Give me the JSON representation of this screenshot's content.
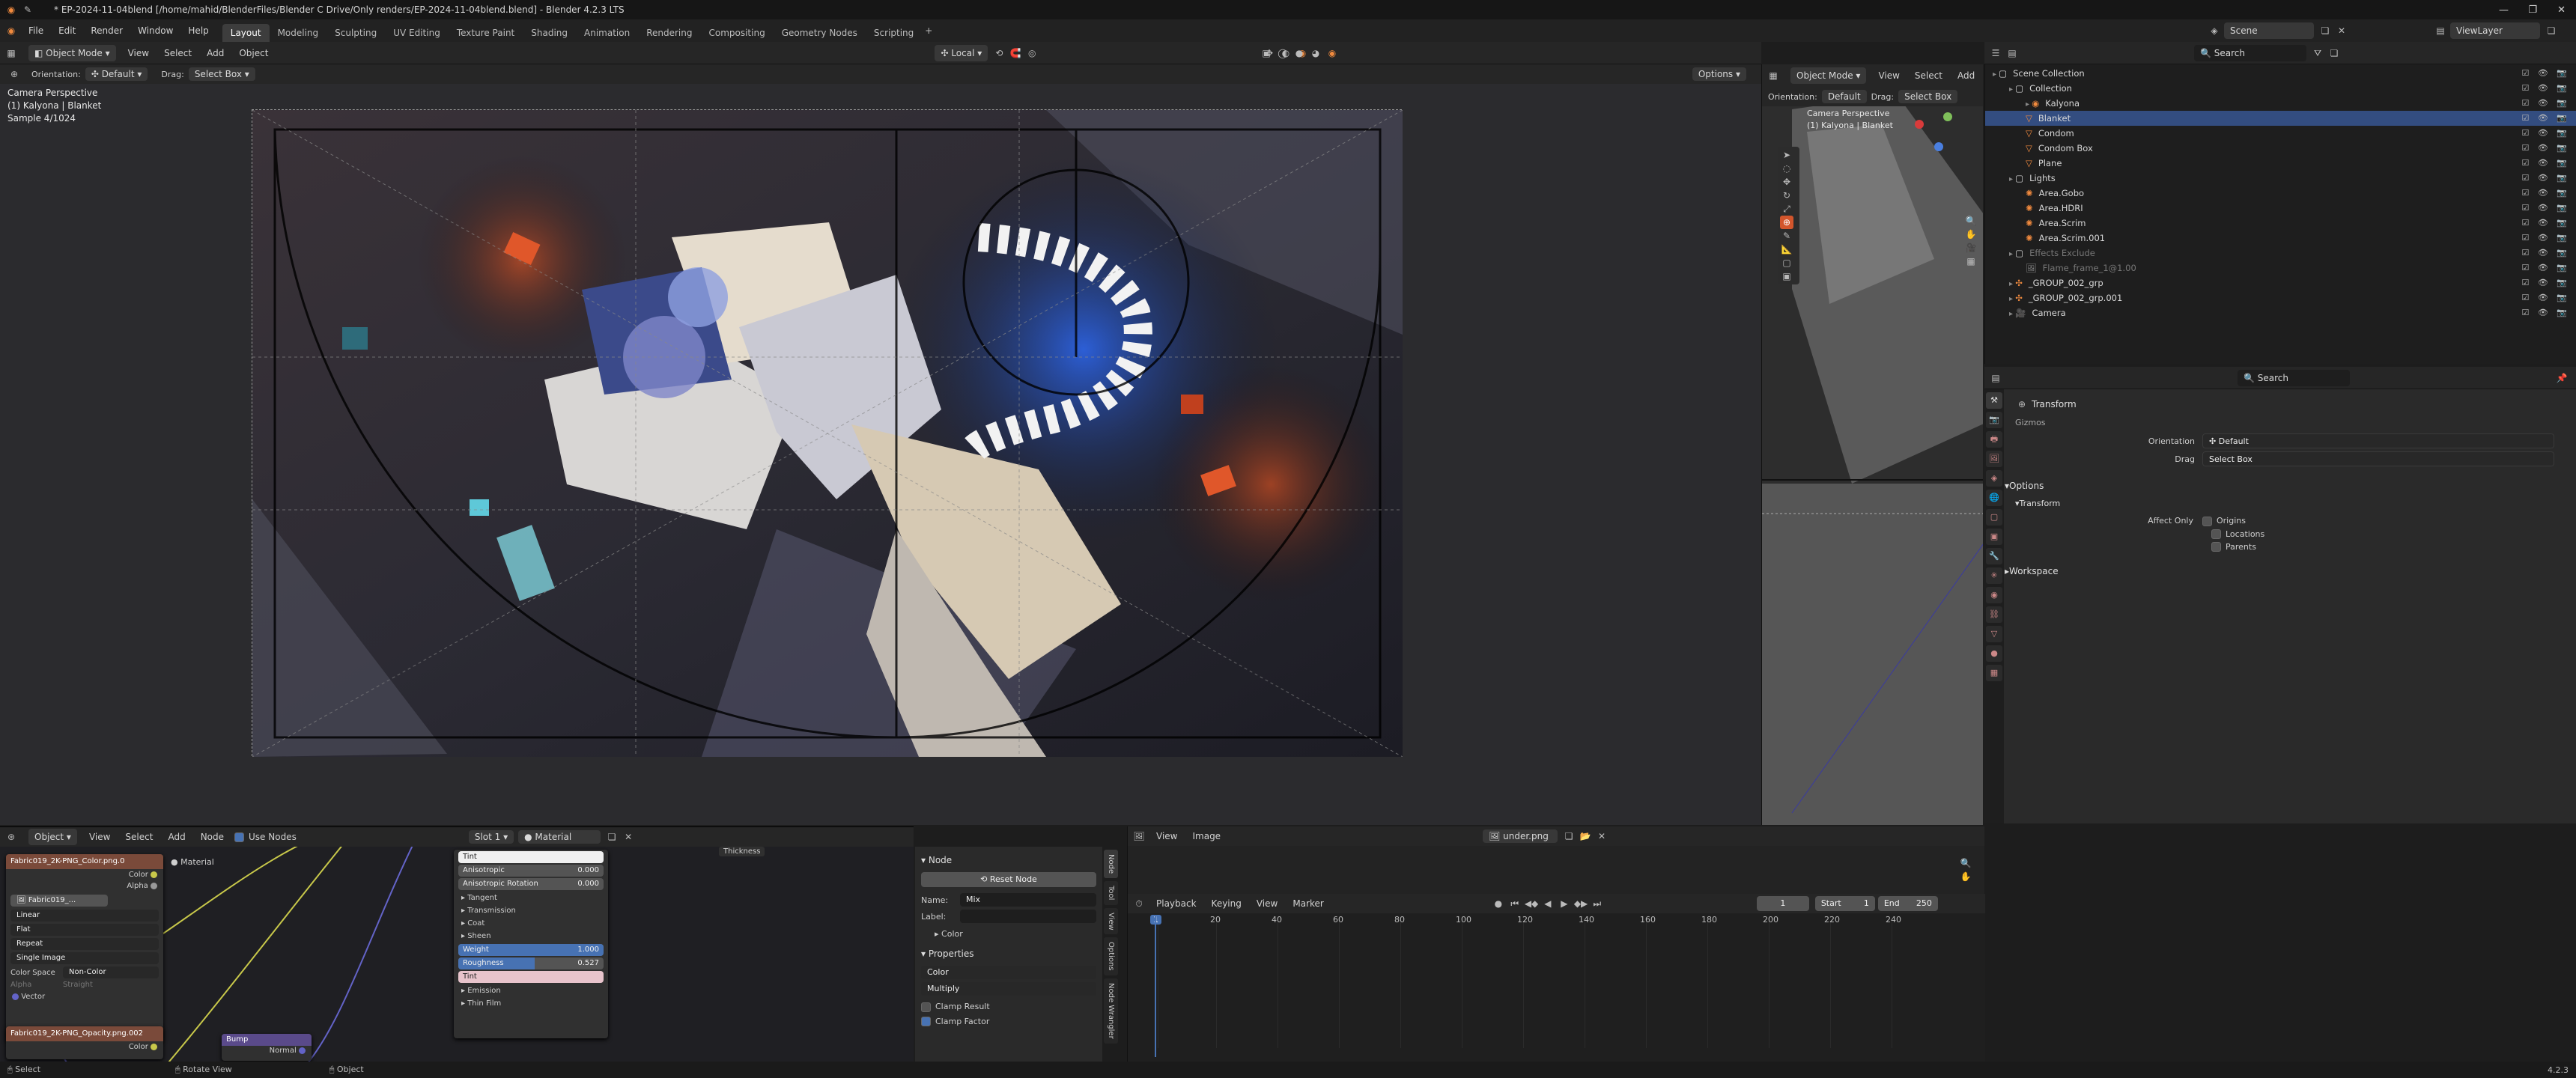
{
  "window": {
    "title": "* EP-2024-11-04blend [/home/mahid/BlenderFiles/Blender C Drive/Only renders/EP-2024-11-04blend.blend] - Blender 4.2.3 LTS"
  },
  "menus": [
    "File",
    "Edit",
    "Render",
    "Window",
    "Help"
  ],
  "workspaces": [
    "Layout",
    "Modeling",
    "Sculpting",
    "UV Editing",
    "Texture Paint",
    "Shading",
    "Animation",
    "Rendering",
    "Compositing",
    "Geometry Nodes",
    "Scripting"
  ],
  "active_workspace": "Layout",
  "scene": {
    "name": "Scene",
    "view_layer": "ViewLayer"
  },
  "viewport": {
    "mode": "Object Mode",
    "menus": [
      "View",
      "Select",
      "Add",
      "Object"
    ],
    "transform_space": "Local",
    "orientation_label": "Orientation:",
    "orientation": "Default",
    "drag_label": "Drag:",
    "drag": "Select Box",
    "options": "Options",
    "overlay_lines": [
      "Camera Perspective",
      "(1) Kalyona | Blanket",
      "Sample 4/1024"
    ]
  },
  "viewport2": {
    "mode": "Object Mode",
    "menus": [
      "View",
      "Select",
      "Add"
    ],
    "orientation_label": "Orientation:",
    "orientation": "Default",
    "drag_label": "Drag:",
    "drag": "Select Box",
    "overlay_lines": [
      "Camera Perspective",
      "(1) Kalyona | Blanket"
    ]
  },
  "outliner": {
    "search_placeholder": "Search",
    "rows": [
      {
        "label": "Scene Collection",
        "indent": 0,
        "icon": "collection-icon",
        "selected": false,
        "dim": false
      },
      {
        "label": "Collection",
        "indent": 1,
        "icon": "collection-icon",
        "selected": false,
        "dim": false
      },
      {
        "label": "Kalyona",
        "indent": 2,
        "icon": "object-icon",
        "selected": false,
        "dim": false
      },
      {
        "label": "Blanket",
        "indent": 2,
        "icon": "mesh-icon",
        "selected": true,
        "dim": false
      },
      {
        "label": "Condom",
        "indent": 2,
        "icon": "mesh-icon",
        "selected": false,
        "dim": false
      },
      {
        "label": "Condom Box",
        "indent": 2,
        "icon": "mesh-icon",
        "selected": false,
        "dim": false
      },
      {
        "label": "Plane",
        "indent": 2,
        "icon": "mesh-icon",
        "selected": false,
        "dim": false
      },
      {
        "label": "Lights",
        "indent": 1,
        "icon": "collection-icon",
        "selected": false,
        "dim": false
      },
      {
        "label": "Area.Gobo",
        "indent": 2,
        "icon": "light-icon",
        "selected": false,
        "dim": false
      },
      {
        "label": "Area.HDRI",
        "indent": 2,
        "icon": "light-icon",
        "selected": false,
        "dim": false
      },
      {
        "label": "Area.Scrim",
        "indent": 2,
        "icon": "light-icon",
        "selected": false,
        "dim": false
      },
      {
        "label": "Area.Scrim.001",
        "indent": 2,
        "icon": "light-icon",
        "selected": false,
        "dim": false
      },
      {
        "label": "Effects Exclude",
        "indent": 1,
        "icon": "collection-icon",
        "selected": false,
        "dim": true
      },
      {
        "label": "Flame_frame_1@1.00",
        "indent": 2,
        "icon": "image-icon",
        "selected": false,
        "dim": true
      },
      {
        "label": "_GROUP_002_grp",
        "indent": 1,
        "icon": "empty-icon",
        "selected": false,
        "dim": false
      },
      {
        "label": "_GROUP_002_grp.001",
        "indent": 1,
        "icon": "empty-icon",
        "selected": false,
        "dim": false
      },
      {
        "label": "Camera",
        "indent": 1,
        "icon": "camera-icon",
        "selected": false,
        "dim": false
      }
    ]
  },
  "properties": {
    "search_placeholder": "Search",
    "title": "Transform",
    "gizmos_label": "Gizmos",
    "orientation_label": "Orientation",
    "orientation": "Default",
    "drag_label": "Drag",
    "drag": "Select Box",
    "options_panel": "Options",
    "transform_sub": "Transform",
    "affect_only_label": "Affect Only",
    "affect_only": [
      "Origins",
      "Locations",
      "Parents"
    ],
    "workspace_panel": "Workspace"
  },
  "node_editor": {
    "mode": "Object",
    "menus": [
      "View",
      "Select",
      "Add",
      "Node"
    ],
    "use_nodes": "Use Nodes",
    "slot": "Slot 1",
    "material": "Material",
    "image_node": {
      "title": "Fabric019_2K-PNG_Color.png.0",
      "image": "Fabric019_...",
      "interp": "Linear",
      "projection": "Flat",
      "extension": "Repeat",
      "source": "Single Image",
      "color_space_label": "Color Space",
      "color_space": "Non-Color",
      "alpha_label": "Alpha",
      "alpha": "Straight",
      "outputs": [
        "Color",
        "Alpha"
      ],
      "vector": "Vector"
    },
    "material_output": "Material",
    "opacity_node": "Fabric019_2K-PNG_Opacity.png.002",
    "opacity_out": "Color",
    "bump_node": "Bump",
    "bump_out": "Normal",
    "bsdf_rows": [
      {
        "label": "Tint",
        "value": "",
        "fill": 0
      },
      {
        "label": "Anisotropic",
        "value": "0.000",
        "fill": 0
      },
      {
        "label": "Anisotropic Rotation",
        "value": "0.000",
        "fill": 0
      },
      {
        "label": "Tangent",
        "value": "",
        "fill": 0
      },
      {
        "label": "Transmission",
        "value": "",
        "fill": 0
      },
      {
        "label": "Coat",
        "value": "",
        "fill": 0
      },
      {
        "label": "Sheen",
        "value": "",
        "fill": 0
      },
      {
        "label": "Weight",
        "value": "1.000",
        "fill": 1
      },
      {
        "label": "Roughness",
        "value": "0.527",
        "fill": 0.527
      },
      {
        "label": "Tint",
        "value": "",
        "fill": 0
      },
      {
        "label": "Emission",
        "value": "",
        "fill": 0
      },
      {
        "label": "Thin Film",
        "value": "",
        "fill": 0
      }
    ],
    "thickness": "Thickness",
    "sidebar": {
      "node_panel": "Node",
      "reset": "Reset Node",
      "name_label": "Name:",
      "name": "Mix",
      "label_label": "Label:",
      "label": "",
      "color_sub": "Color",
      "properties_panel": "Properties",
      "data_type": "Color",
      "blend": "Multiply",
      "clamp_result": "Clamp Result",
      "clamp_factor": "Clamp Factor",
      "tabs": [
        "Node",
        "Tool",
        "View",
        "Options",
        "Node Wrangler"
      ]
    }
  },
  "image_editor": {
    "menus": [
      "View",
      "Image"
    ],
    "image_name": "under.png"
  },
  "timeline": {
    "menus": [
      "Playback",
      "Keying",
      "View",
      "Marker"
    ],
    "current": "1",
    "start_label": "Start",
    "start": "1",
    "end_label": "End",
    "end": "250",
    "ticks": [
      "1",
      "20",
      "40",
      "60",
      "80",
      "100",
      "120",
      "140",
      "160",
      "180",
      "200",
      "220",
      "240"
    ]
  },
  "statusbar": {
    "items": [
      "Select",
      "Rotate View",
      "Object"
    ],
    "version": "4.2.3"
  },
  "colors": {
    "accent": "#4772b3",
    "selection": "#334d80",
    "object_orange": "#f08a3e",
    "mesh_green": "#7fbf5a"
  }
}
